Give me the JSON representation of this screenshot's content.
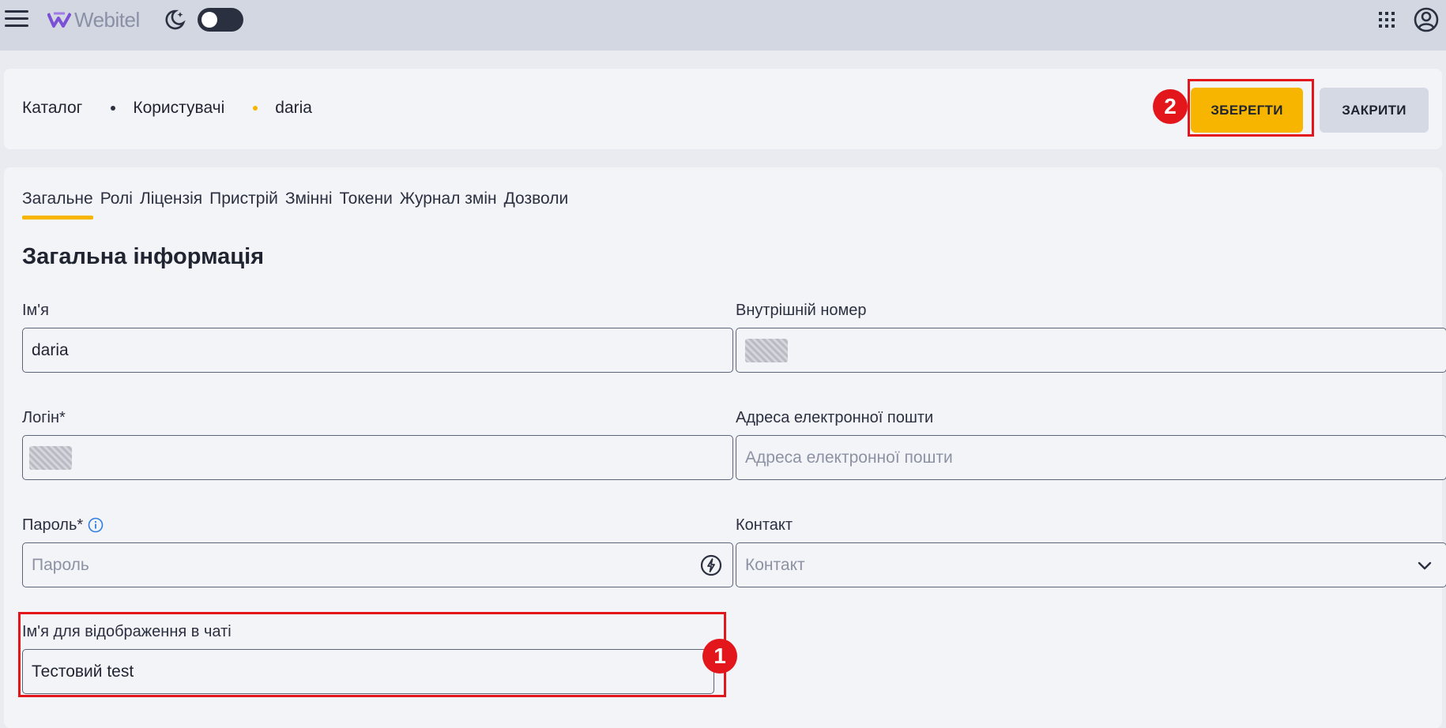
{
  "topbar": {
    "logo_text": "Webitel",
    "theme_toggle_on": false,
    "icons": [
      "hamburger-menu-icon",
      "webitel-logo-icon",
      "moon-icon",
      "apps-grid-icon",
      "account-icon"
    ]
  },
  "breadcrumb": {
    "items": [
      "Каталог",
      "Користувачі",
      "daria"
    ]
  },
  "actions": {
    "save_label": "ЗБЕРЕГТИ",
    "close_label": "ЗАКРИТИ",
    "save_color": "#f7b500",
    "close_color": "#d5d9e3"
  },
  "annotations": {
    "badge_1": "1",
    "badge_2": "2",
    "highlight_color": "#e3161c"
  },
  "tabs": [
    {
      "label": "Загальне",
      "active": true
    },
    {
      "label": "Ролі",
      "active": false
    },
    {
      "label": "Ліцензія",
      "active": false
    },
    {
      "label": "Пристрій",
      "active": false
    },
    {
      "label": "Змінні",
      "active": false
    },
    {
      "label": "Токени",
      "active": false
    },
    {
      "label": "Журнал змін",
      "active": false
    },
    {
      "label": "Дозволи",
      "active": false
    }
  ],
  "section_title": "Загальна інформація",
  "form": {
    "name": {
      "label": "Ім'я",
      "value": "daria"
    },
    "extension": {
      "label": "Внутрішній номер",
      "value": ""
    },
    "login": {
      "label": "Логін*",
      "value": ""
    },
    "email": {
      "label": "Адреса електронної пошти",
      "placeholder": "Адреса електронної пошти"
    },
    "password": {
      "label": "Пароль*",
      "placeholder": "Пароль"
    },
    "contact": {
      "label": "Контакт",
      "placeholder": "Контакт"
    },
    "chat_name": {
      "label": "Ім'я для відображення в чаті",
      "value": "Тестовий test"
    }
  }
}
